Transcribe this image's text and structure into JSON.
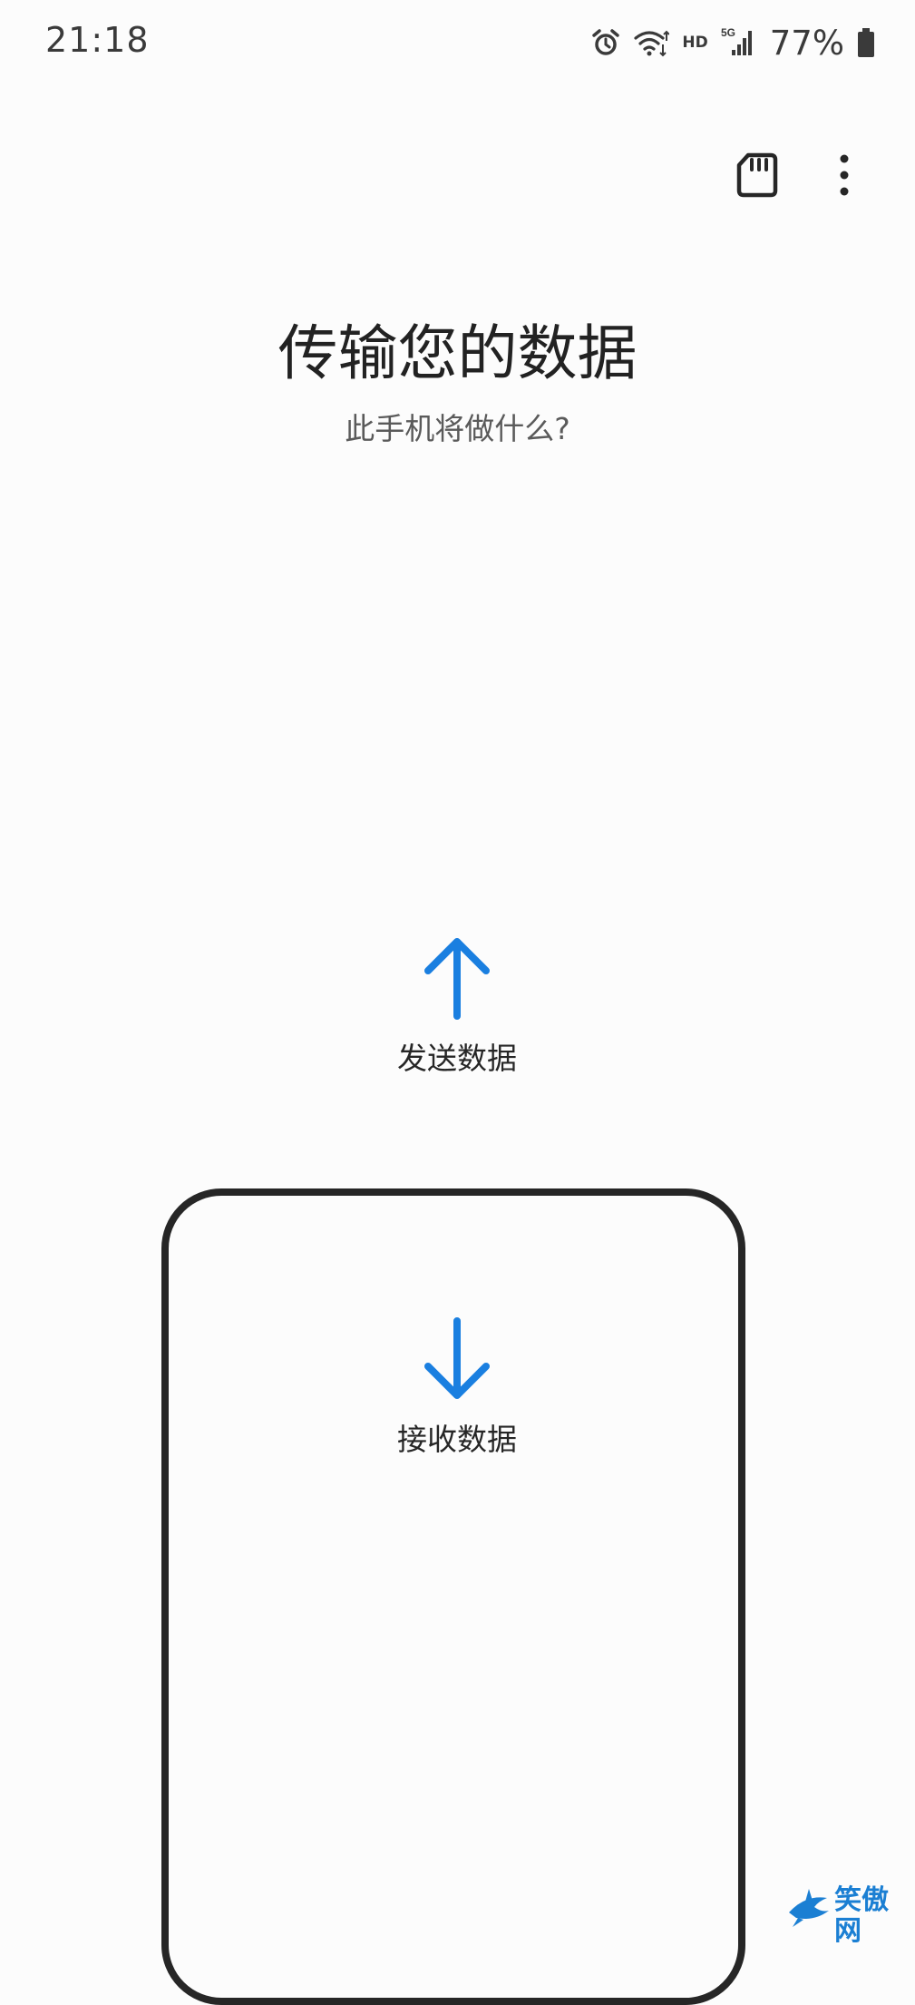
{
  "status_bar": {
    "time": "21:18",
    "icons": [
      "alarm-icon",
      "wifi-icon",
      "hd-voice-icon",
      "5g-signal-icon",
      "battery-icon"
    ],
    "hd_label": "HD",
    "network_label": "5G",
    "battery_percent": "77%"
  },
  "app_bar": {
    "actions": [
      "sd-card-icon",
      "more-options-icon"
    ]
  },
  "header": {
    "title": "传输您的数据",
    "subtitle": "此手机将做什么?"
  },
  "options": {
    "send": {
      "label": "发送数据",
      "icon": "arrow-up-icon"
    },
    "receive": {
      "label": "接收数据",
      "icon": "arrow-down-icon"
    }
  },
  "colors": {
    "accent": "#1a7fe0",
    "text": "#252525",
    "background": "#fcfcfc",
    "phone_outline": "#262626"
  },
  "watermark": {
    "text": "笑傲网"
  }
}
